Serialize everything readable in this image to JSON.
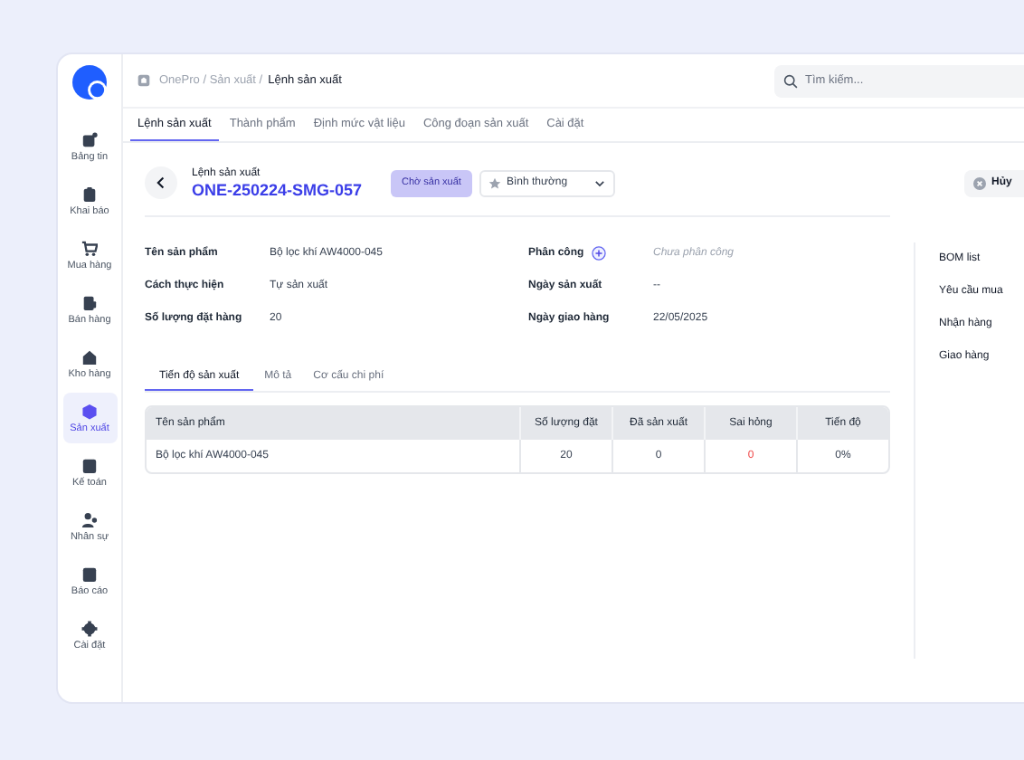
{
  "sidebar": {
    "items": [
      {
        "label": "Bảng tin",
        "selected": false
      },
      {
        "label": "Khai báo",
        "selected": false
      },
      {
        "label": "Mua hàng",
        "selected": false
      },
      {
        "label": "Bán hàng",
        "selected": false
      },
      {
        "label": "Kho hàng",
        "selected": false
      },
      {
        "label": "Sản xuất",
        "selected": true
      },
      {
        "label": "Kế toán",
        "selected": false
      },
      {
        "label": "Nhân sự",
        "selected": false
      },
      {
        "label": "Báo cáo",
        "selected": false
      },
      {
        "label": "Cài đặt",
        "selected": false
      }
    ]
  },
  "breadcrumb": {
    "path": "OnePro / Sản xuất /",
    "current": "Lệnh sản xuất"
  },
  "search": {
    "placeholder": "Tìm kiếm..."
  },
  "tabs": [
    {
      "label": "Lệnh sản xuất",
      "selected": true
    },
    {
      "label": "Thành phẩm",
      "selected": false
    },
    {
      "label": "Định mức vật liệu",
      "selected": false
    },
    {
      "label": "Công đoạn sản xuất",
      "selected": false
    },
    {
      "label": "Cài đặt",
      "selected": false
    }
  ],
  "header": {
    "caption": "Lệnh sản xuất",
    "code": "ONE-250224-SMG-057",
    "status": "Chờ sản xuất",
    "priority": "Bình thường",
    "cancel_button": "Hủy"
  },
  "fields": [
    {
      "label": "Tên sản phẩm",
      "value": "Bộ lọc khí AW4000-045",
      "kind": "text"
    },
    {
      "label": "Phân công",
      "value": "Chưa phân công",
      "kind": "assign"
    },
    {
      "label": "Cách thực hiện",
      "value": "Tự sản xuất",
      "kind": "text"
    },
    {
      "label": "Ngày sản xuất",
      "value": "--",
      "kind": "text"
    },
    {
      "label": "Số lượng đặt hàng",
      "value": "20",
      "kind": "text"
    },
    {
      "label": "Ngày giao hàng",
      "value": "22/05/2025",
      "kind": "text"
    }
  ],
  "side_panel": {
    "items": [
      "BOM list",
      "Yêu cầu mua",
      "Nhận hàng",
      "Giao hàng"
    ]
  },
  "sub_tabs": [
    {
      "label": "Tiến độ sản xuất",
      "selected": true
    },
    {
      "label": "Mô tả",
      "selected": false
    },
    {
      "label": "Cơ cấu chi phí",
      "selected": false
    }
  ],
  "table": {
    "columns": [
      "Tên sản phẩm",
      "Số lượng đặt",
      "Đã sản xuất",
      "Sai hỏng",
      "Tiến độ"
    ],
    "rows": [
      [
        {
          "text": "Bộ lọc khí AW4000-045",
          "kind": "normal"
        },
        {
          "text": "20",
          "kind": "normal"
        },
        {
          "text": "0",
          "kind": "normal"
        },
        {
          "text": "0",
          "kind": "defect"
        },
        {
          "text": "0%",
          "kind": "normal"
        }
      ]
    ]
  }
}
